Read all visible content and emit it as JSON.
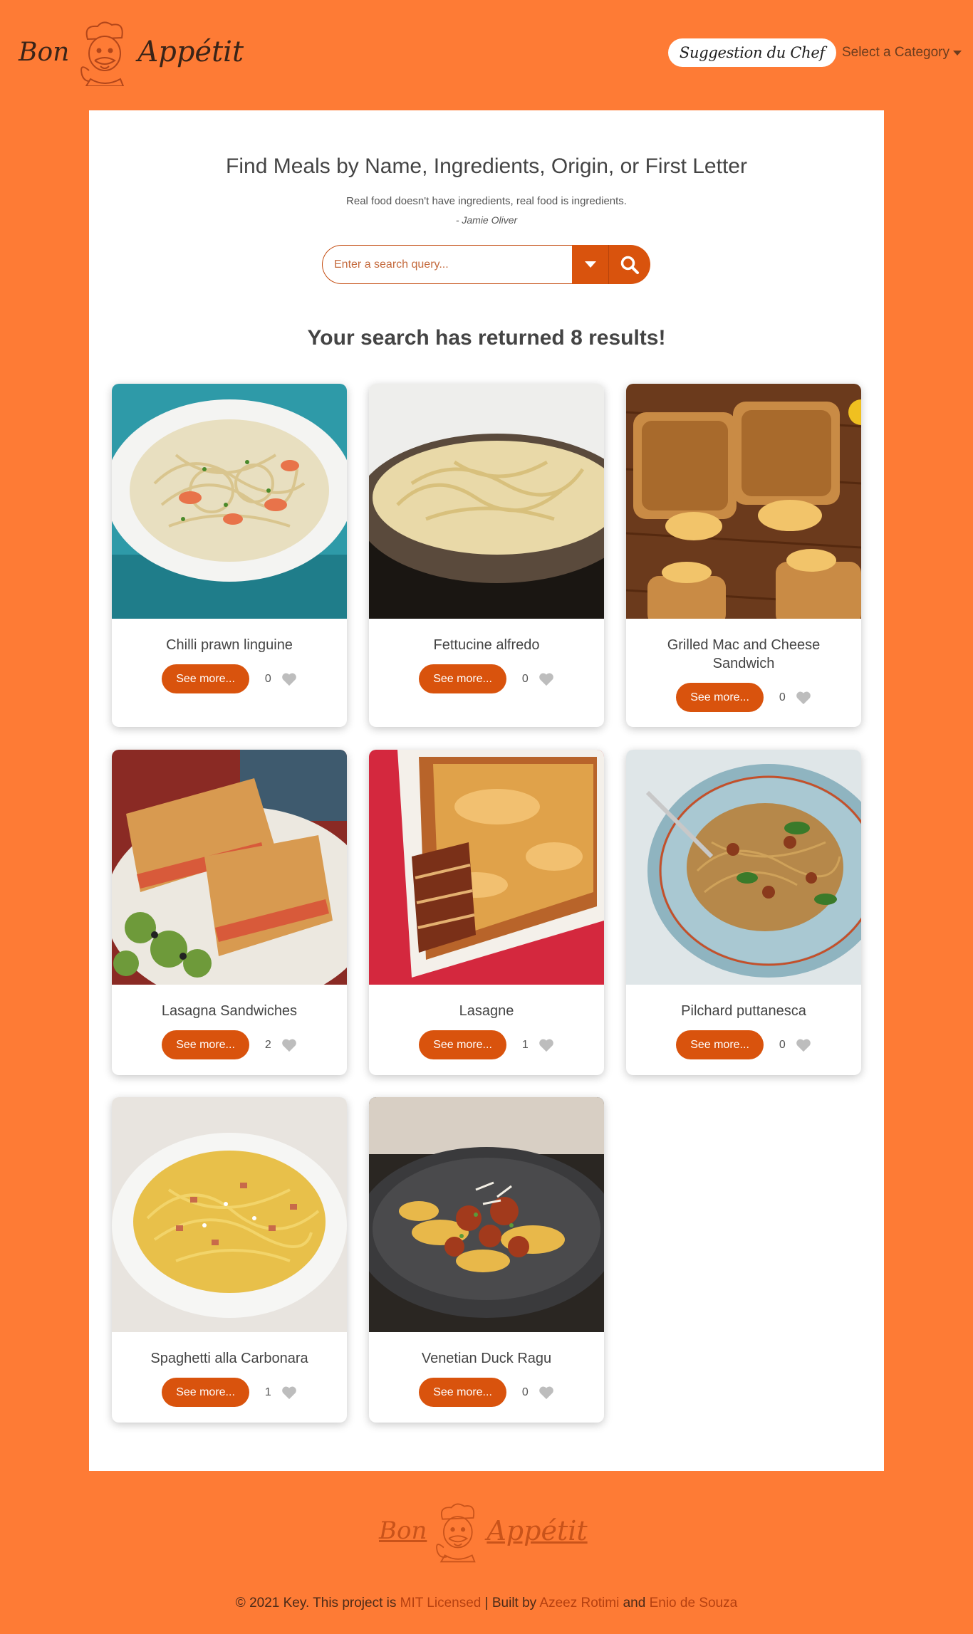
{
  "brand": {
    "word1": "Bon",
    "word2": "Appétit"
  },
  "nav": {
    "chef_suggestion": "Suggestion du Chef",
    "category_dropdown": "Select a Category"
  },
  "hero": {
    "title": "Find Meals by Name, Ingredients, Origin, or First Letter",
    "quote": "Real food doesn't have ingredients, real food is ingredients.",
    "quote_author": "- Jamie Oliver"
  },
  "search": {
    "placeholder": "Enter a search query..."
  },
  "results_text": "Your search has returned 8 results!",
  "cards": [
    {
      "name": "Chilli prawn linguine",
      "button": "See more...",
      "likes": "0"
    },
    {
      "name": "Fettucine alfredo",
      "button": "See more...",
      "likes": "0"
    },
    {
      "name": "Grilled Mac and Cheese Sandwich",
      "button": "See more...",
      "likes": "0"
    },
    {
      "name": "Lasagna Sandwiches",
      "button": "See more...",
      "likes": "2"
    },
    {
      "name": "Lasagne",
      "button": "See more...",
      "likes": "1"
    },
    {
      "name": "Pilchard puttanesca",
      "button": "See more...",
      "likes": "0"
    },
    {
      "name": "Spaghetti alla Carbonara",
      "button": "See more...",
      "likes": "1"
    },
    {
      "name": "Venetian Duck Ragu",
      "button": "See more...",
      "likes": "0"
    }
  ],
  "footer": {
    "copyright": "© 2021 Key. This project is",
    "license_link": "MIT Licensed",
    "built_by": "| Built by",
    "author1": "Azeez Rotimi",
    "and": "and",
    "author2": "Enio de Souza"
  },
  "colors": {
    "background": "#fe7b35",
    "accent": "#d9530d",
    "panel": "#ffffff"
  }
}
